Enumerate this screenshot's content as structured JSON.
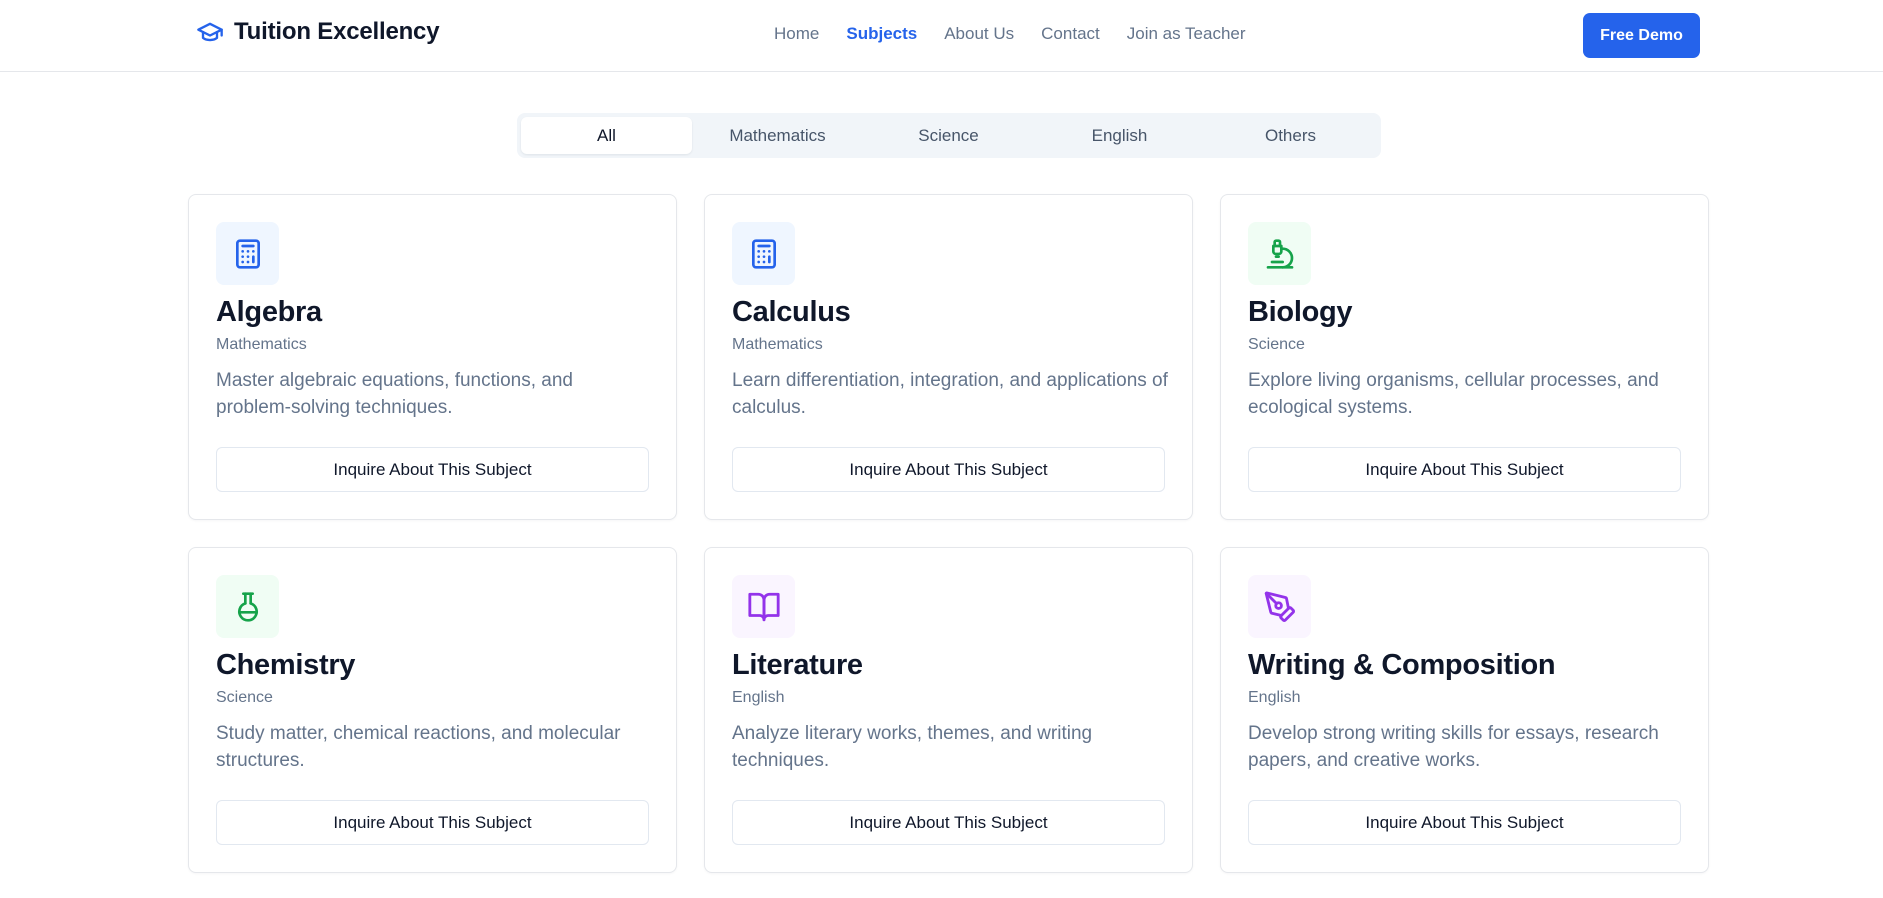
{
  "header": {
    "brand": "Tuition Excellency",
    "brand_icon": "graduation-cap-icon",
    "nav": [
      "Home",
      "Subjects",
      "About Us",
      "Contact",
      "Join as Teacher"
    ],
    "active_nav": "Subjects",
    "cta": "Free Demo"
  },
  "tabs": {
    "items": [
      "All",
      "Mathematics",
      "Science",
      "English",
      "Others"
    ],
    "active": "All"
  },
  "subjects": [
    {
      "title": "Algebra",
      "category": "Mathematics",
      "description": "Master algebraic equations, functions, and problem-solving techniques.",
      "button": "Inquire About This Subject",
      "icon": "calculator-icon",
      "accent": "#2563eb",
      "icon_bg": "#eff6ff"
    },
    {
      "title": "Calculus",
      "category": "Mathematics",
      "description": "Learn differentiation, integration, and applications of calculus.",
      "button": "Inquire About This Subject",
      "icon": "calculator-icon",
      "accent": "#2563eb",
      "icon_bg": "#eff6ff"
    },
    {
      "title": "Biology",
      "category": "Science",
      "description": "Explore living organisms, cellular processes, and ecological systems.",
      "button": "Inquire About This Subject",
      "icon": "microscope-icon",
      "accent": "#16a34a",
      "icon_bg": "#f0fdf4"
    },
    {
      "title": "Chemistry",
      "category": "Science",
      "description": "Study matter, chemical reactions, and molecular structures.",
      "button": "Inquire About This Subject",
      "icon": "flask-icon",
      "accent": "#16a34a",
      "icon_bg": "#f0fdf4"
    },
    {
      "title": "Literature",
      "category": "English",
      "description": "Analyze literary works, themes, and writing techniques.",
      "button": "Inquire About This Subject",
      "icon": "book-open-icon",
      "accent": "#9333ea",
      "icon_bg": "#faf5ff"
    },
    {
      "title": "Writing & Composition",
      "category": "English",
      "description": "Develop strong writing skills for essays, research papers, and creative works.",
      "button": "Inquire About This Subject",
      "icon": "pen-tool-icon",
      "accent": "#9333ea",
      "icon_bg": "#faf5ff"
    }
  ],
  "colors": {
    "primary": "#2563eb",
    "text": "#0f172a",
    "muted": "#64748b",
    "border": "#e5e7eb"
  }
}
